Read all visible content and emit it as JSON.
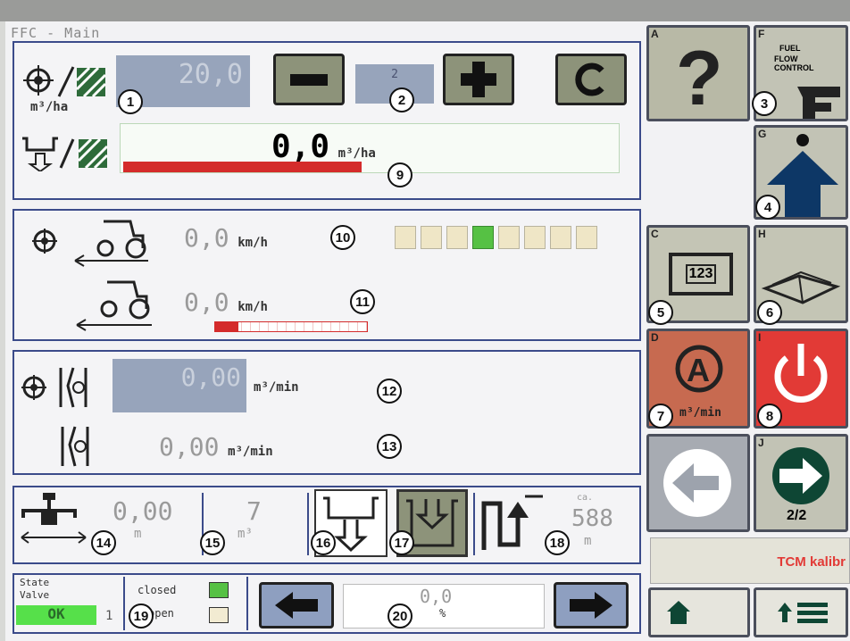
{
  "header": {
    "title": "FFC - Main"
  },
  "rate": {
    "value": "20,0",
    "unit": "m³/ha",
    "section": "2",
    "actual": "0,0",
    "actual_unit": "m³/ha",
    "actual_fill": 0.48
  },
  "speed": {
    "target": "0,0",
    "target_unit": "km/h",
    "actual": "0,0",
    "actual_unit": "km/h",
    "gear_count": 8,
    "gear_active": 4,
    "bar_fill": 0.15
  },
  "flow": {
    "target": "0,00",
    "target_unit": "m³/min",
    "actual": "0,00",
    "actual_unit": "m³/min"
  },
  "tank": {
    "distance": "0,00",
    "distance_unit": "m",
    "volume": "7",
    "volume_unit": "m³",
    "range_prefix": "ca.",
    "range": "588",
    "range_unit": "m"
  },
  "state": {
    "label_line1": "State",
    "label_line2": "Valve",
    "status": "OK",
    "valve_no": "1",
    "closed": "closed",
    "open": "open",
    "gauge": "0,0",
    "gauge_unit": "%"
  },
  "softkeys": {
    "A": "A",
    "F": "F",
    "G": "G",
    "C": "C",
    "H": "H",
    "D": "D",
    "I": "I",
    "J": "J",
    "ffc_logo": "FLOW CONTROL",
    "ffc_logo_top": "FUEL",
    "counter": "123",
    "auto_unit": "m³/min",
    "page": "2/2",
    "tcm": "TCM kalibr"
  },
  "markers": [
    "1",
    "2",
    "3",
    "4",
    "5",
    "6",
    "7",
    "8",
    "9",
    "10",
    "11",
    "12",
    "13",
    "14",
    "15",
    "16",
    "17",
    "18",
    "19",
    "20"
  ],
  "colors": {
    "frame": "#3b4b8a",
    "valuebox": "#97a4bb",
    "button": "#8d937a",
    "red": "#d42b2b",
    "green": "#56c144"
  }
}
